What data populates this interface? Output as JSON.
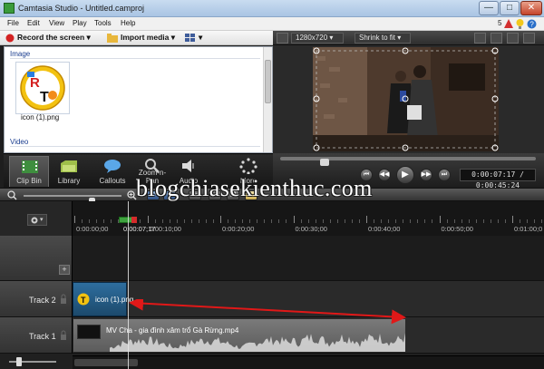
{
  "window": {
    "title": "Camtasia Studio - Untitled.camproj",
    "controls": [
      "—",
      "□",
      "✕"
    ]
  },
  "menu": {
    "items": [
      "File",
      "Edit",
      "View",
      "Play",
      "Tools",
      "Help"
    ],
    "notification_count": "5"
  },
  "toolbar": {
    "record_label": "Record the screen",
    "import_label": "Import media"
  },
  "clip_bin": {
    "image_section": "Image",
    "video_section": "Video",
    "media": [
      {
        "name": "icon (1).png"
      }
    ]
  },
  "tabs": [
    {
      "label": "Clip Bin",
      "icon": "film-strip-icon",
      "active": true
    },
    {
      "label": "Library",
      "icon": "folder-icon",
      "active": false
    },
    {
      "label": "Callouts",
      "icon": "speech-bubble-icon",
      "active": false
    },
    {
      "label": "Zoom-n-Pan",
      "icon": "magnifier-icon",
      "active": false
    },
    {
      "label": "Audio",
      "icon": "speaker-icon",
      "active": false
    },
    {
      "label": "More",
      "icon": "more-icon",
      "active": false
    }
  ],
  "preview": {
    "dimensions": "1280x720",
    "fit_mode": "Shrink to fit",
    "progress_fraction": 0.16,
    "time_display": "0:00:07:17 / 0:00:45:24"
  },
  "timeline": {
    "playhead_time": "0:00:07;17",
    "tick_labels": [
      "0:00:00;00",
      "0:00:10;00",
      "0:00:20;00",
      "0:00:30;00",
      "0:00:40;00",
      "0:00:50;00",
      "0:01:00;0"
    ],
    "tracks": [
      {
        "label": "Track 2",
        "clip": "icon (1).png"
      },
      {
        "label": "Track 1",
        "clip": "MV Cha - gia đình xâm trổ Gà Rừng.mp4"
      }
    ]
  },
  "watermark": "blogchiasekienthuc.com",
  "colors": {
    "accent_green": "#3fa33f",
    "playhead_red": "#d42b2b",
    "image_clip_blue": "#2e6e9e",
    "annotation_arrow": "#e01818"
  }
}
